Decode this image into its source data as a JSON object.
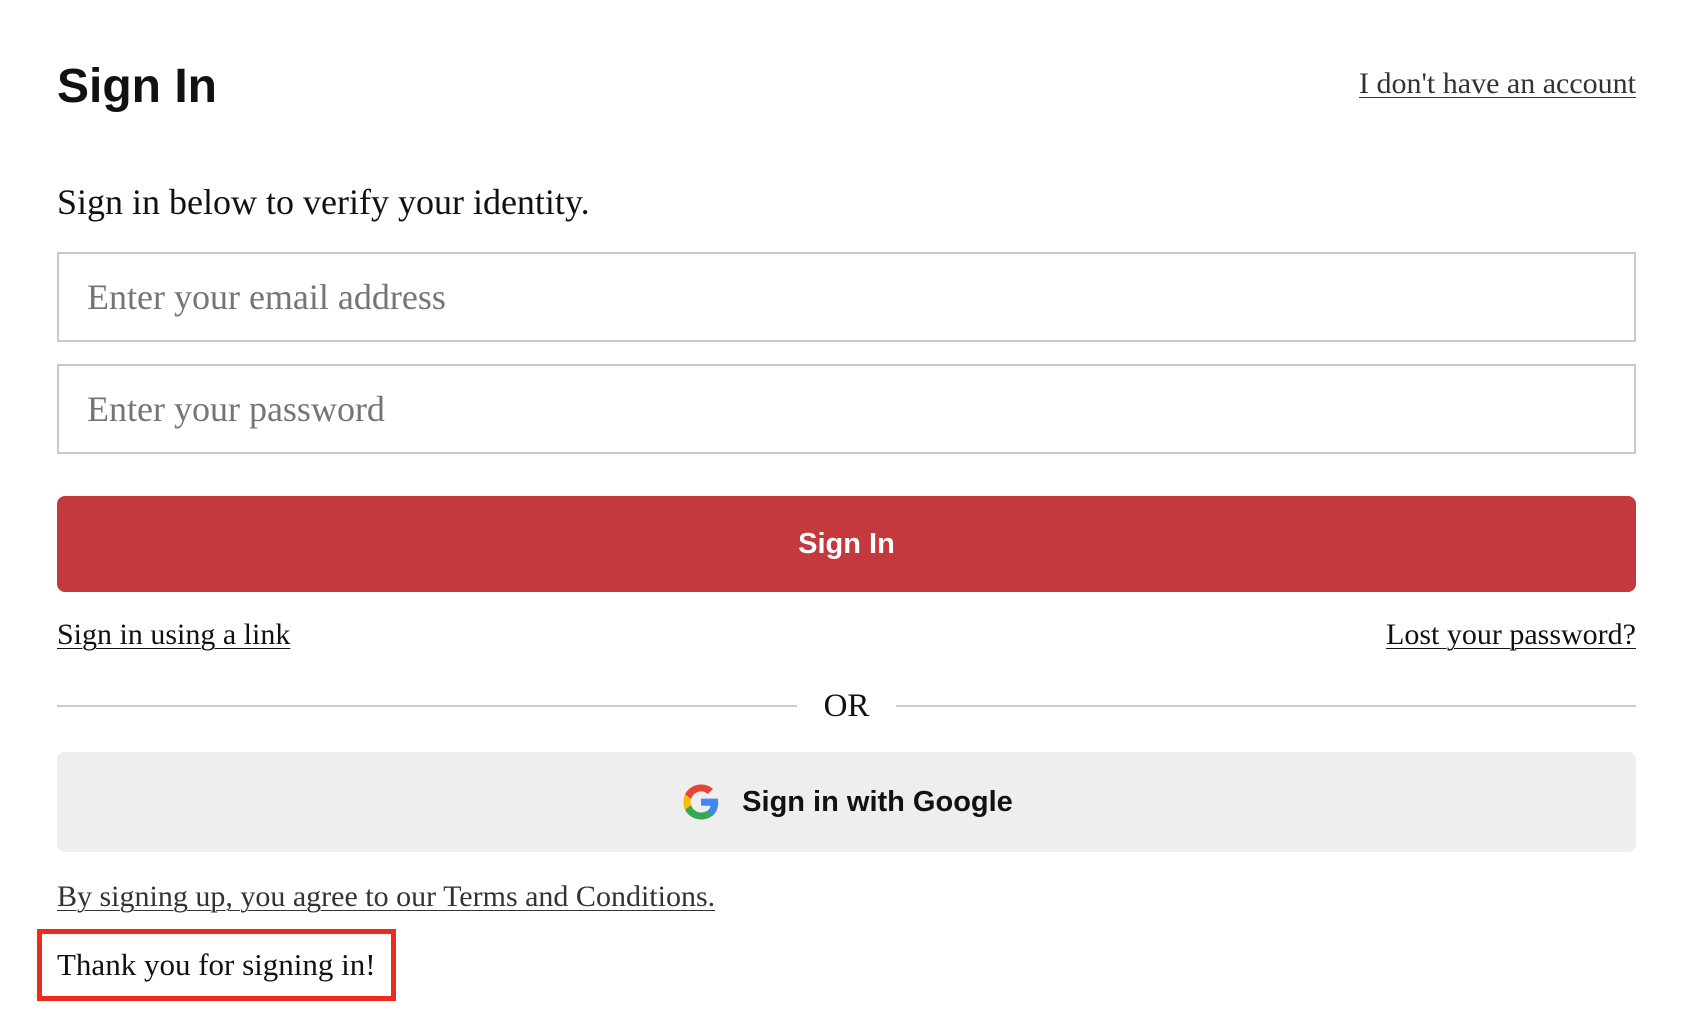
{
  "header": {
    "title": "Sign In",
    "account_link": "I don't have an account"
  },
  "form": {
    "subtitle": "Sign in below to verify your identity.",
    "email": {
      "value": "",
      "placeholder": "Enter your email address"
    },
    "password": {
      "value": "",
      "placeholder": "Enter your password"
    },
    "submit_label": "Sign In",
    "submit_color": "#c4393d",
    "link_signin": "Sign in using a link",
    "link_lost_password": "Lost your password?"
  },
  "divider": {
    "label": "OR"
  },
  "google": {
    "label": "Sign in with Google",
    "icon": "google-g-icon"
  },
  "footer": {
    "terms_text": "By signing up, you agree to our Terms and Conditions.",
    "confirmation_message": "Thank you for signing in!",
    "confirmation_highlight_color": "#ee2a1f"
  }
}
